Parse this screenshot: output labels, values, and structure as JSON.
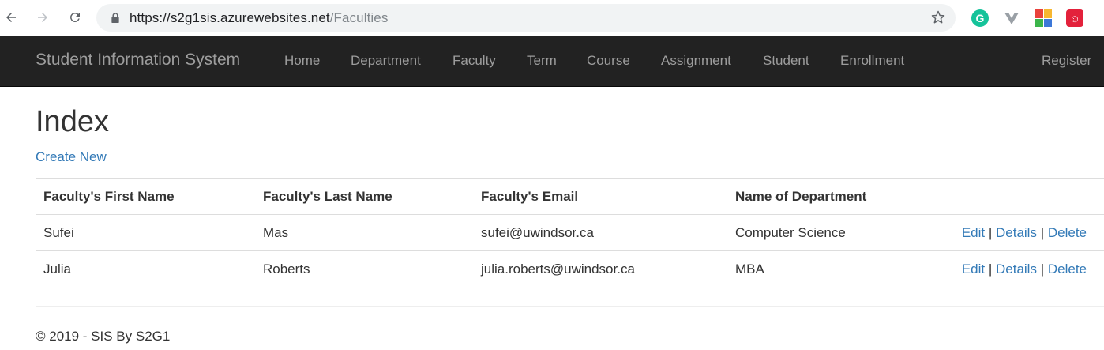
{
  "browser": {
    "url_host": "https://s2g1sis.azurewebsites.net",
    "url_path": "/Faculties",
    "extensions": [
      "grammarly-icon",
      "vue-devtools-icon",
      "color-grid-icon",
      "red-extension-icon"
    ],
    "ext_g_letter": "G"
  },
  "navbar": {
    "brand": "Student Information System",
    "items": [
      {
        "label": "Home"
      },
      {
        "label": "Department"
      },
      {
        "label": "Faculty"
      },
      {
        "label": "Term"
      },
      {
        "label": "Course"
      },
      {
        "label": "Assignment"
      },
      {
        "label": "Student"
      },
      {
        "label": "Enrollment"
      }
    ],
    "register": "Register"
  },
  "page": {
    "title": "Index",
    "create_new": "Create New"
  },
  "table": {
    "headers": [
      "Faculty's First Name",
      "Faculty's Last Name",
      "Faculty's Email",
      "Name of Department"
    ],
    "rows": [
      {
        "first": "Sufei",
        "last": "Mas",
        "email": "sufei@uwindsor.ca",
        "department": "Computer Science"
      },
      {
        "first": "Julia",
        "last": "Roberts",
        "email": "julia.roberts@uwindsor.ca",
        "department": "MBA"
      }
    ],
    "actions": {
      "edit": "Edit",
      "details": "Details",
      "delete": "Delete",
      "separator": "|"
    }
  },
  "footer": {
    "text": "© 2019 - SIS By S2G1"
  },
  "colors": {
    "navbar_bg": "#222222",
    "nav_text": "#9d9d9d",
    "link": "#337ab7"
  }
}
